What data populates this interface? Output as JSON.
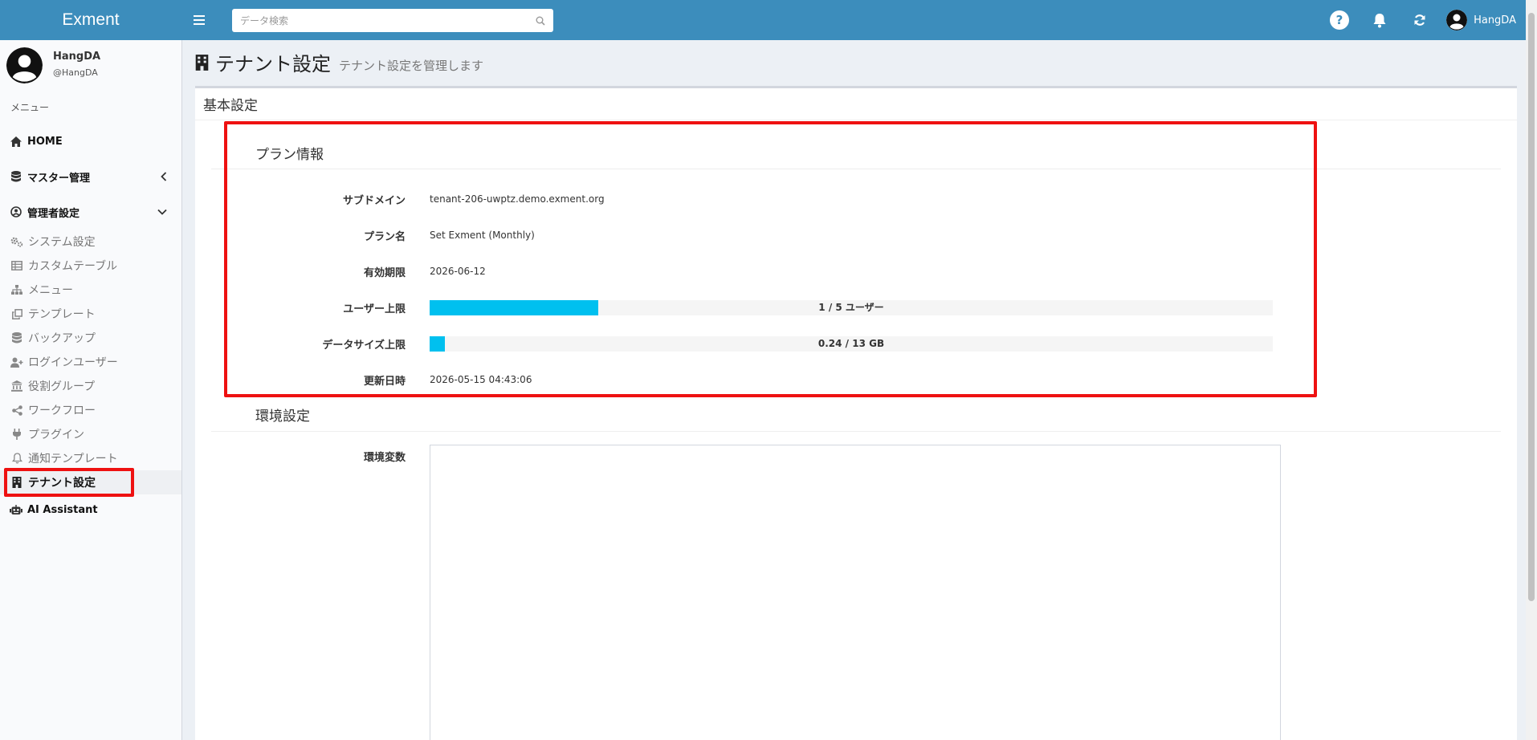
{
  "app": {
    "title": "Exment"
  },
  "search": {
    "placeholder": "データ検索"
  },
  "header_user": {
    "name": "HangDA"
  },
  "sidebar": {
    "user_name": "HangDA",
    "user_handle": "@HangDA",
    "menu_label": "メニュー",
    "home_label": "HOME",
    "master_label": "マスター管理",
    "admin_label": "管理者設定",
    "admin_items": [
      {
        "label": "システム設定",
        "icon": "cogs-icon"
      },
      {
        "label": "カスタムテーブル",
        "icon": "table-icon"
      },
      {
        "label": "メニュー",
        "icon": "sitemap-icon"
      },
      {
        "label": "テンプレート",
        "icon": "clone-icon"
      },
      {
        "label": "バックアップ",
        "icon": "database-icon"
      },
      {
        "label": "ログインユーザー",
        "icon": "user-plus-icon"
      },
      {
        "label": "役割グループ",
        "icon": "institution-icon"
      },
      {
        "label": "ワークフロー",
        "icon": "share-alt-icon"
      },
      {
        "label": "プラグイン",
        "icon": "plug-icon"
      },
      {
        "label": "通知テンプレート",
        "icon": "bell-icon"
      },
      {
        "label": "テナント設定",
        "icon": "building-icon",
        "active": true
      }
    ],
    "ai_label": "AI Assistant"
  },
  "page": {
    "title": "テナント設定",
    "subtitle": "テナント設定を管理します",
    "box_title": "基本設定"
  },
  "plan": {
    "section_title": "プラン情報",
    "subdomain_label": "サブドメイン",
    "subdomain_value": "tenant-206-uwptz.demo.exment.org",
    "plan_name_label": "プラン名",
    "plan_name_value": "Set Exment (Monthly)",
    "expiry_label": "有効期限",
    "expiry_value": "2026-06-12",
    "user_limit_label": "ユーザー上限",
    "user_limit_text": "1 / 5 ユーザー",
    "user_limit_fraction": 0.2,
    "data_limit_label": "データサイズ上限",
    "data_limit_text": "0.24 / 13 GB",
    "data_limit_fraction": 0.0185,
    "updated_label": "更新日時",
    "updated_value": "2026-05-15 04:43:06"
  },
  "env": {
    "section_title": "環境設定",
    "env_label": "環境変数",
    "env_value": ""
  },
  "colors": {
    "topbar": "#3c8dbc",
    "progress_fill": "#00c0ef",
    "highlight": "#ee1111"
  }
}
